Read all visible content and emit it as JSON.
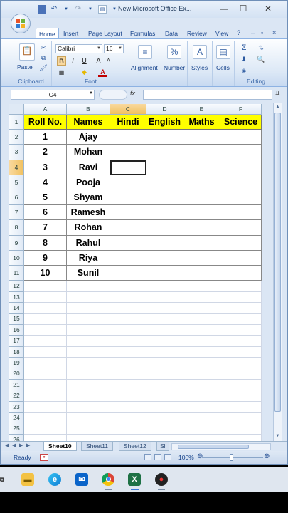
{
  "window": {
    "title": "New Microsoft Office Ex...",
    "controls": {
      "minimize": "—",
      "maximize": "☐",
      "close": "✕"
    }
  },
  "ribbon": {
    "tabs": [
      "Home",
      "Insert",
      "Page Layout",
      "Formulas",
      "Data",
      "Review",
      "View"
    ],
    "active_tab": "Home",
    "clipboard": {
      "paste": "Paste",
      "label": "Clipboard"
    },
    "font": {
      "name": "Calibri",
      "size": "16",
      "label": "Font",
      "bold": "B",
      "italic": "I",
      "underline": "U"
    },
    "alignment": {
      "label": "Alignment"
    },
    "number": {
      "label": "Number",
      "icon_text": "%"
    },
    "styles": {
      "label": "Styles"
    },
    "cells": {
      "label": "Cells"
    },
    "editing": {
      "label": "Editing",
      "sum": "Σ"
    }
  },
  "formula_bar": {
    "name_box": "C4",
    "fx": "fx",
    "value": ""
  },
  "columns": [
    "A",
    "B",
    "C",
    "D",
    "E",
    "F"
  ],
  "rows": [
    "1",
    "2",
    "3",
    "4",
    "5",
    "6",
    "7",
    "8",
    "9",
    "10",
    "11",
    "12",
    "13",
    "14",
    "15",
    "16",
    "17",
    "18",
    "19",
    "20",
    "21",
    "22",
    "23",
    "24",
    "25",
    "26"
  ],
  "table": {
    "headers": [
      "Roll No.",
      "Names",
      "Hindi",
      "English",
      "Maths",
      "Science"
    ],
    "records": [
      [
        "1",
        "Ajay"
      ],
      [
        "2",
        "Mohan"
      ],
      [
        "3",
        "Ravi"
      ],
      [
        "4",
        "Pooja"
      ],
      [
        "5",
        "Shyam"
      ],
      [
        "6",
        "Ramesh"
      ],
      [
        "7",
        "Rohan"
      ],
      [
        "8",
        "Rahul"
      ],
      [
        "9",
        "Riya"
      ],
      [
        "10",
        "Sunil"
      ]
    ]
  },
  "selection": {
    "cell": "C4"
  },
  "sheets": [
    "Sheet10",
    "Sheet11",
    "Sheet12",
    "Sl"
  ],
  "active_sheet": "Sheet10",
  "status": {
    "ready": "Ready",
    "zoom": "100%"
  },
  "colors": {
    "header_fill": "#ffff00",
    "accent": "#15428b"
  },
  "taskbar": {
    "icons": [
      "explorer-icon",
      "edge-icon",
      "mail-icon",
      "chrome-icon",
      "excel-icon",
      "app-icon"
    ]
  }
}
